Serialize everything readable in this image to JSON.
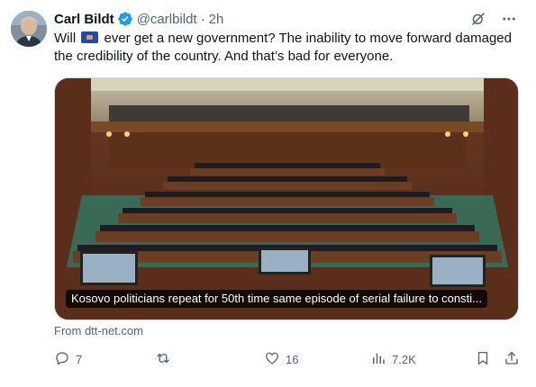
{
  "author": {
    "name": "Carl Bildt",
    "handle": "@carlbildt",
    "separator": "·",
    "time": "2h",
    "verified": true
  },
  "tweet": {
    "text_before_flag": "Will",
    "flag_icon": "kosovo-flag-icon",
    "text_after_flag": "ever get a new government? The inability to move forward damaged the credibility of the country. And that’s bad for everyone."
  },
  "card": {
    "caption": "Kosovo politicians repeat for 50th time same episode of serial failure to consti...",
    "source": "From dtt-net.com"
  },
  "actions": {
    "replies": "7",
    "reposts": "",
    "likes": "16",
    "views": "7.2K"
  },
  "colors": {
    "verified_blue": "#1d9bf0",
    "secondary_text": "#536471",
    "primary_text": "#0f1419"
  },
  "icons": [
    "grok-icon",
    "more-icon",
    "reply-icon",
    "repost-icon",
    "like-icon",
    "views-icon",
    "bookmark-icon",
    "share-icon"
  ]
}
